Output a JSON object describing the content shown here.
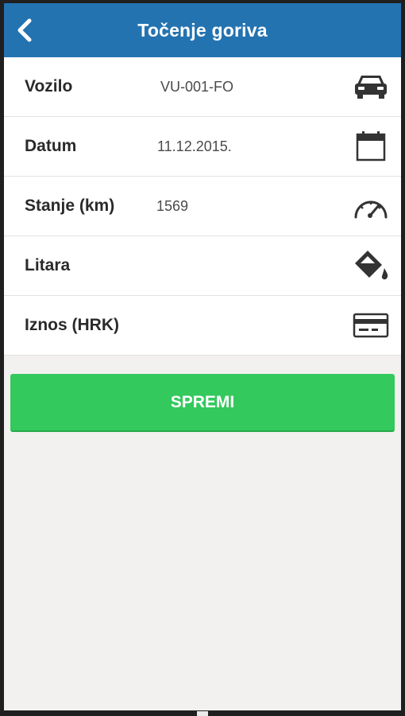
{
  "header": {
    "title": "Točenje goriva",
    "back_icon": "chevron-left-icon"
  },
  "form": {
    "vehicle": {
      "label": "Vozilo",
      "value": "VU-001-FO",
      "icon": "car-icon"
    },
    "date": {
      "label": "Datum",
      "value": "11.12.2015.",
      "icon": "calendar-icon"
    },
    "odometer": {
      "label": "Stanje (km)",
      "value": "1569",
      "icon": "speedometer-icon"
    },
    "liters": {
      "label": "Litara",
      "value": "",
      "icon": "paint-bucket-icon"
    },
    "amount": {
      "label": "Iznos (HRK)",
      "value": "",
      "icon": "credit-card-icon"
    }
  },
  "actions": {
    "save_label": "SPREMI"
  },
  "colors": {
    "header": "#2473b1",
    "accent_green": "#33c95c",
    "background": "#f2f1ef",
    "icon": "#333333"
  }
}
